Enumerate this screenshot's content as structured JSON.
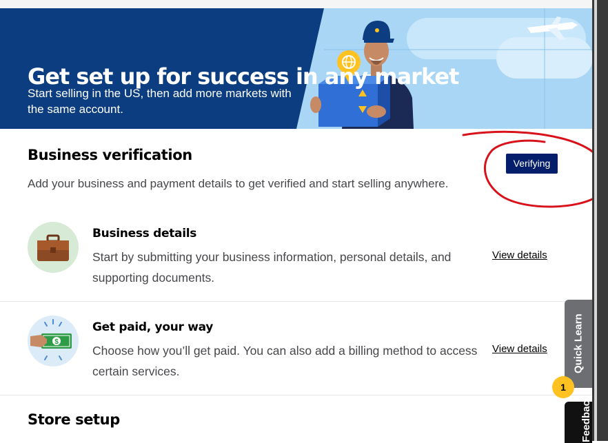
{
  "hero": {
    "title": "Get set up for success in any market",
    "subtitle": "Start selling in the US, then add more markets with the same account."
  },
  "verification": {
    "title": "Business verification",
    "description": "Add your business and payment details to get verified and start selling anywhere.",
    "status": "Verifying",
    "items": [
      {
        "title": "Business details",
        "description": "Start by submitting your business information, personal details, and supporting documents.",
        "link": "View details",
        "icon": "briefcase-icon"
      },
      {
        "title": "Get paid, your way",
        "description": "Choose how you’ll get paid. You can also add a billing method to access certain services.",
        "link": "View details",
        "icon": "cash-icon"
      }
    ]
  },
  "store_setup": {
    "title": "Store setup"
  },
  "side_tabs": {
    "quick_learn": "Quick Learn",
    "quick_learn_count": "1",
    "feedback": "Feedback"
  },
  "colors": {
    "hero_dark": "#0b3d80",
    "hero_light": "#a9d6f5",
    "badge": "#041e6b",
    "annotation": "#d8121a",
    "accent_yellow": "#ffc220"
  }
}
